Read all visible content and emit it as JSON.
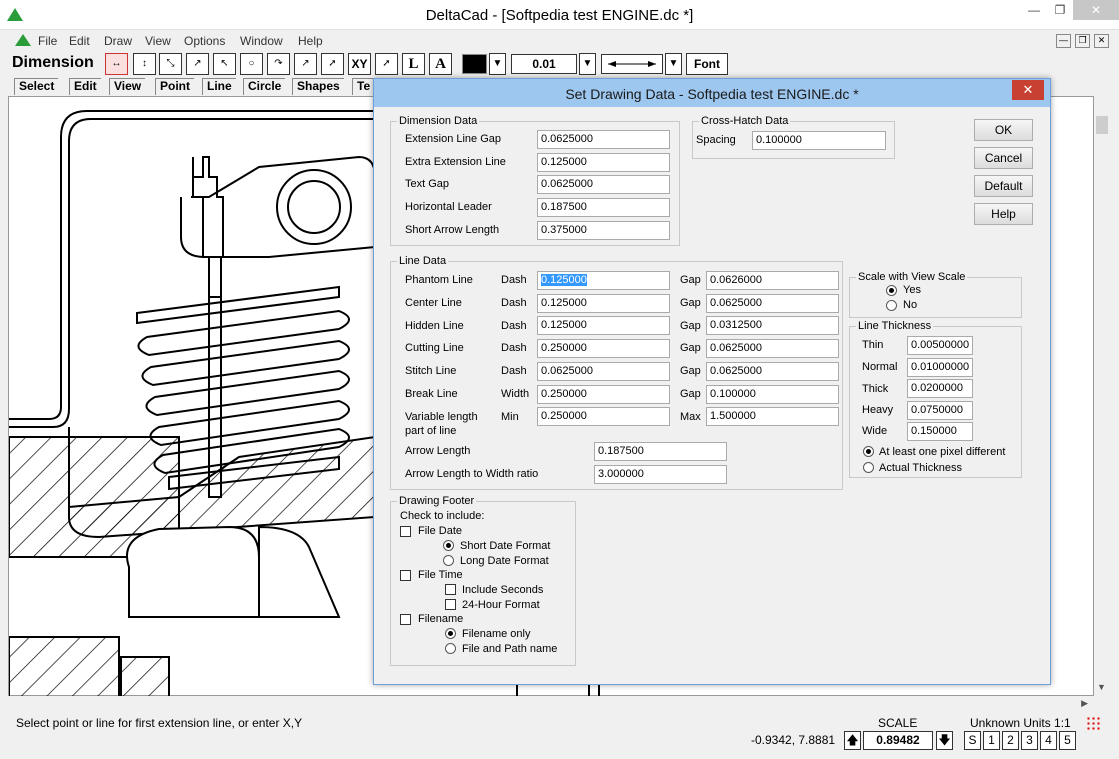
{
  "window": {
    "title": "DeltaCad - [Softpedia test ENGINE.dc *]"
  },
  "menu": [
    "File",
    "Edit",
    "Draw",
    "View",
    "Options",
    "Window",
    "Help"
  ],
  "toolbar": {
    "mode_label": "Dimension",
    "xy_label": "XY",
    "l_label": "L",
    "a_label": "A",
    "size_value": "0.01",
    "font_label": "Font"
  },
  "tabs": [
    "Select",
    "Edit",
    "View",
    "Point",
    "Line",
    "Circle",
    "Shapes",
    "Te"
  ],
  "status": {
    "message": "Select point or line for first extension line, or enter X,Y",
    "coords": "-0.9342, 7.8881",
    "scale_label": "SCALE",
    "scale_value": "0.89482",
    "units": "Unknown Units 1:1",
    "scale_buttons": [
      "S",
      "1",
      "2",
      "3",
      "4",
      "5"
    ]
  },
  "dialog": {
    "title": "Set Drawing Data - Softpedia test ENGINE.dc *",
    "buttons": {
      "ok": "OK",
      "cancel": "Cancel",
      "default": "Default",
      "help": "Help"
    },
    "dimension": {
      "legend": "Dimension Data",
      "rows": [
        {
          "label": "Extension Line Gap",
          "value": "0.0625000"
        },
        {
          "label": "Extra Extension Line",
          "value": "0.125000"
        },
        {
          "label": "Text Gap",
          "value": "0.0625000"
        },
        {
          "label": "Horizontal Leader",
          "value": "0.187500"
        },
        {
          "label": "Short Arrow Length",
          "value": "0.375000"
        }
      ]
    },
    "crosshatch": {
      "legend": "Cross-Hatch Data",
      "label": "Spacing",
      "value": "0.100000"
    },
    "line_data": {
      "legend": "Line Data",
      "rows": [
        {
          "label": "Phantom Line",
          "k1": "Dash",
          "v1": "0.125000",
          "k2": "Gap",
          "v2": "0.0626000"
        },
        {
          "label": "Center Line",
          "k1": "Dash",
          "v1": "0.125000",
          "k2": "Gap",
          "v2": "0.0625000"
        },
        {
          "label": "Hidden Line",
          "k1": "Dash",
          "v1": "0.125000",
          "k2": "Gap",
          "v2": "0.0312500"
        },
        {
          "label": "Cutting Line",
          "k1": "Dash",
          "v1": "0.250000",
          "k2": "Gap",
          "v2": "0.0625000"
        },
        {
          "label": "Stitch Line",
          "k1": "Dash",
          "v1": "0.0625000",
          "k2": "Gap",
          "v2": "0.0625000"
        },
        {
          "label": "Break Line",
          "k1": "Width",
          "v1": "0.250000",
          "k2": "Gap",
          "v2": "0.100000"
        },
        {
          "label": "Variable length",
          "label2": "part of line",
          "k1": "Min",
          "v1": "0.250000",
          "k2": "Max",
          "v2": "1.500000"
        }
      ],
      "arrow_length_label": "Arrow Length",
      "arrow_length": "0.187500",
      "arrow_ratio_label": "Arrow Length to Width ratio",
      "arrow_ratio": "3.000000"
    },
    "scale": {
      "legend": "Scale with View Scale",
      "yes": "Yes",
      "no": "No"
    },
    "thickness": {
      "legend": "Line Thickness",
      "rows": [
        {
          "label": "Thin",
          "value": "0.00500000"
        },
        {
          "label": "Normal",
          "value": "0.01000000"
        },
        {
          "label": "Thick",
          "value": "0.0200000"
        },
        {
          "label": "Heavy",
          "value": "0.0750000"
        },
        {
          "label": "Wide",
          "value": "0.150000"
        }
      ],
      "opt1": "At least one pixel different",
      "opt2": "Actual Thickness"
    },
    "footer": {
      "legend": "Drawing Footer",
      "check_label": "Check to include:",
      "file_date": "File Date",
      "short_date": "Short Date Format",
      "long_date": "Long Date Format",
      "file_time": "File Time",
      "include_seconds": "Include Seconds",
      "hour24": "24-Hour Format",
      "filename": "Filename",
      "filename_only": "Filename only",
      "file_path": "File and Path name"
    }
  }
}
